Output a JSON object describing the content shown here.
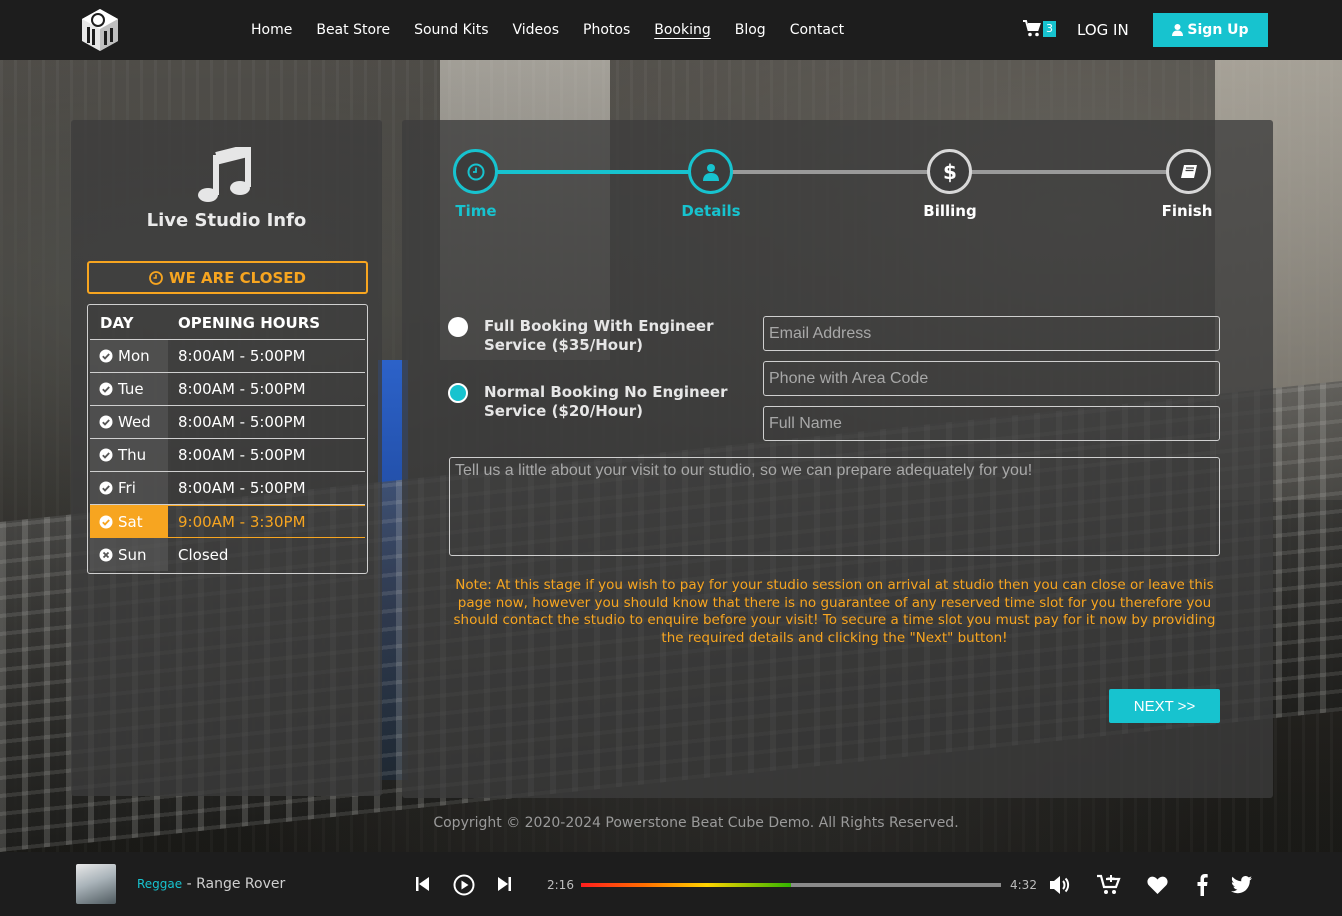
{
  "nav": {
    "items": [
      "Home",
      "Beat Store",
      "Sound Kits",
      "Videos",
      "Photos",
      "Booking",
      "Blog",
      "Contact"
    ],
    "active": "Booking",
    "cart_count": "3",
    "login_label": "LOG IN",
    "signup_label": "Sign Up"
  },
  "studio": {
    "title": "Live Studio Info",
    "status": "WE ARE CLOSED",
    "table_head": {
      "day": "DAY",
      "hours": "OPENING HOURS"
    },
    "days": [
      {
        "day": "Mon",
        "hours": "8:00AM - 5:00PM"
      },
      {
        "day": "Tue",
        "hours": "8:00AM - 5:00PM"
      },
      {
        "day": "Wed",
        "hours": "8:00AM - 5:00PM"
      },
      {
        "day": "Thu",
        "hours": "8:00AM - 5:00PM"
      },
      {
        "day": "Fri",
        "hours": "8:00AM - 5:00PM"
      },
      {
        "day": "Sat",
        "hours": "9:00AM - 3:30PM"
      },
      {
        "day": "Sun",
        "hours": "Closed"
      }
    ]
  },
  "steps": [
    {
      "label": "Time",
      "icon": "clock-icon",
      "state": "done"
    },
    {
      "label": "Details",
      "icon": "user-icon",
      "state": "active"
    },
    {
      "label": "Billing",
      "icon": "dollar-icon",
      "state": "pending"
    },
    {
      "label": "Finish",
      "icon": "book-icon",
      "state": "pending"
    }
  ],
  "booking": {
    "option_full": "Full Booking With Engineer Service ($35/Hour)",
    "option_normal": "Normal Booking No Engineer Service ($20/Hour)",
    "email_placeholder": "Email Address",
    "phone_placeholder": "Phone with Area Code",
    "name_placeholder": "Full Name",
    "message_placeholder": "Tell us a little about your visit to our studio, so we can prepare adequately for you!",
    "note": "Note: At this stage if you wish to pay for your studio session on arrival at studio then you can close or leave this page now, however you should know that there is no guarantee of any reserved time slot for you therefore you should contact the studio to enquire before your visit! To secure a time slot you must pay for it now by providing the required details and clicking the \"Next\" button!",
    "next_label": "NEXT >>"
  },
  "footer": {
    "copyright": "Copyright © 2020-2024 Powerstone Beat Cube Demo. All Rights Reserved."
  },
  "player": {
    "genre": "Reggae",
    "separator": " - ",
    "title": "Range Rover",
    "current_time": "2:16",
    "total_time": "4:32",
    "progress_fraction": 0.5
  },
  "colors": {
    "accent": "#17c3cf",
    "warning": "#f7a520",
    "header_bg": "#1d1d1d"
  }
}
